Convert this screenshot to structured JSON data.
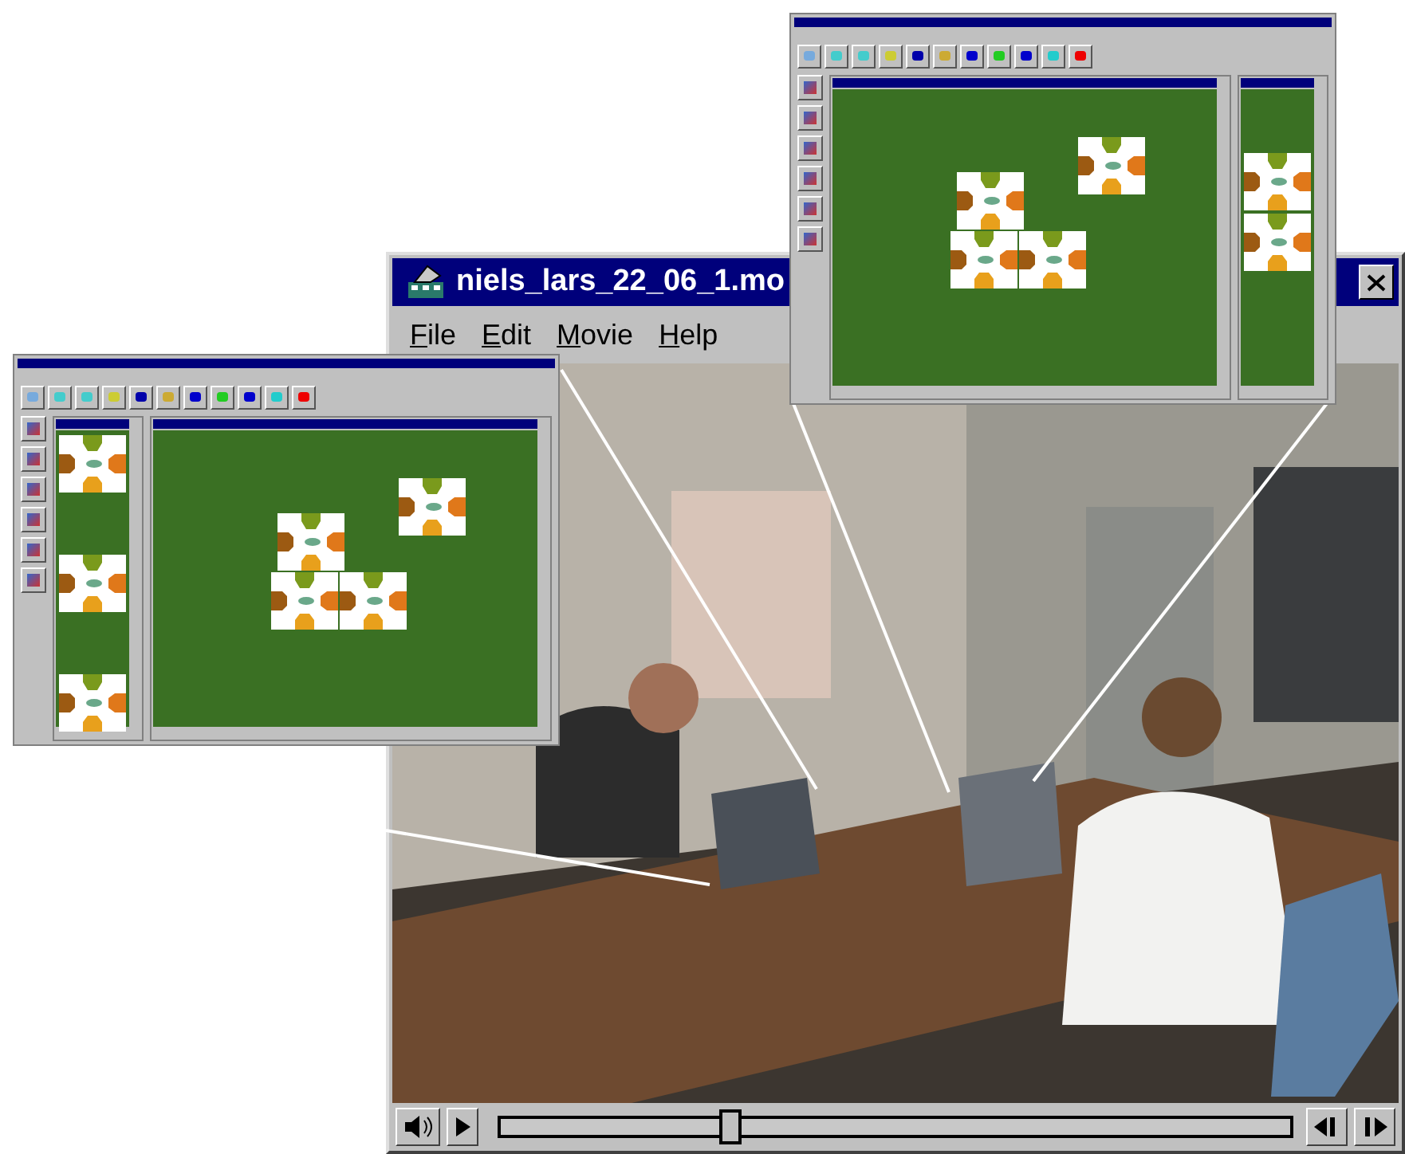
{
  "window": {
    "title": "niels_lars_22_06_1.mo"
  },
  "menu": [
    {
      "label": "File"
    },
    {
      "label": "Edit"
    },
    {
      "label": "Movie"
    },
    {
      "label": "Help"
    }
  ],
  "controls": {
    "level": 0.29
  },
  "insets": [
    {
      "kind": "palette-left"
    },
    {
      "kind": "palette-right"
    }
  ]
}
